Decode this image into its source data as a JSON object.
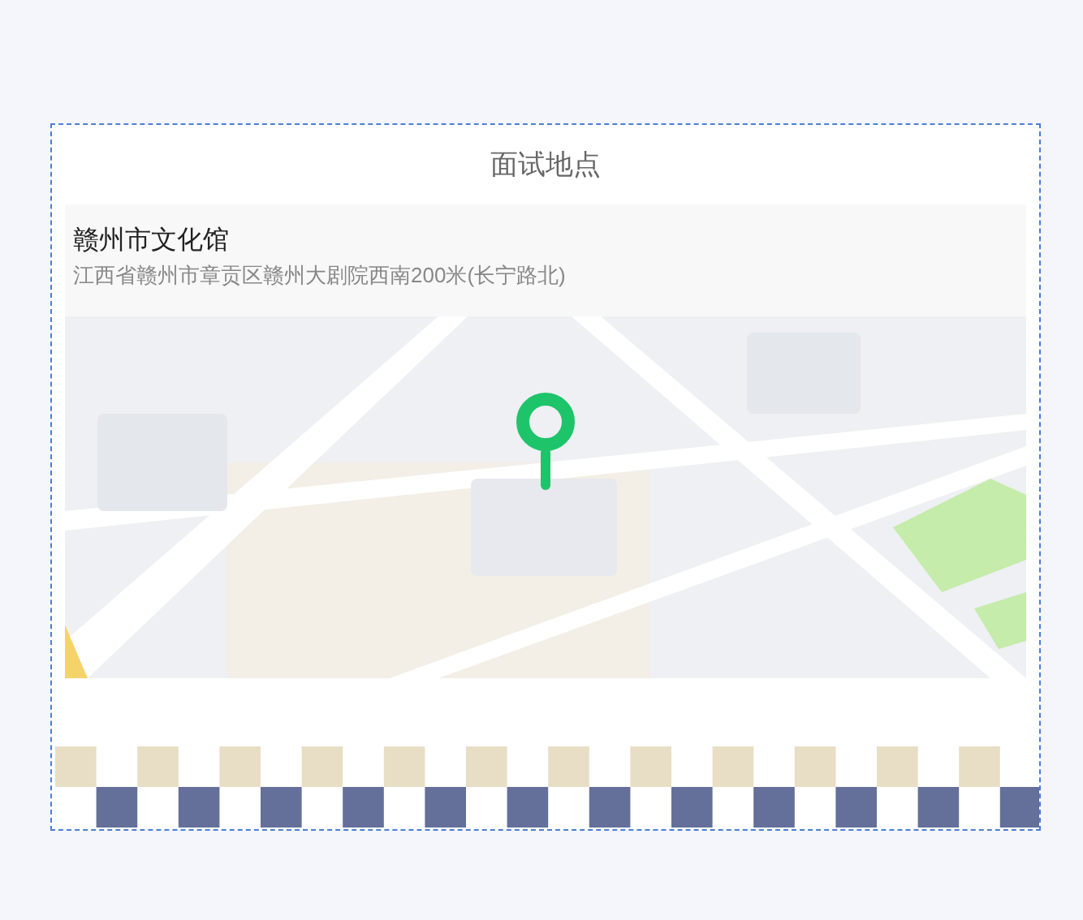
{
  "card": {
    "title": "面试地点"
  },
  "location": {
    "name": "赣州市文化馆",
    "address": "江西省赣州市章贡区赣州大剧院西南200米(长宁路北)"
  }
}
